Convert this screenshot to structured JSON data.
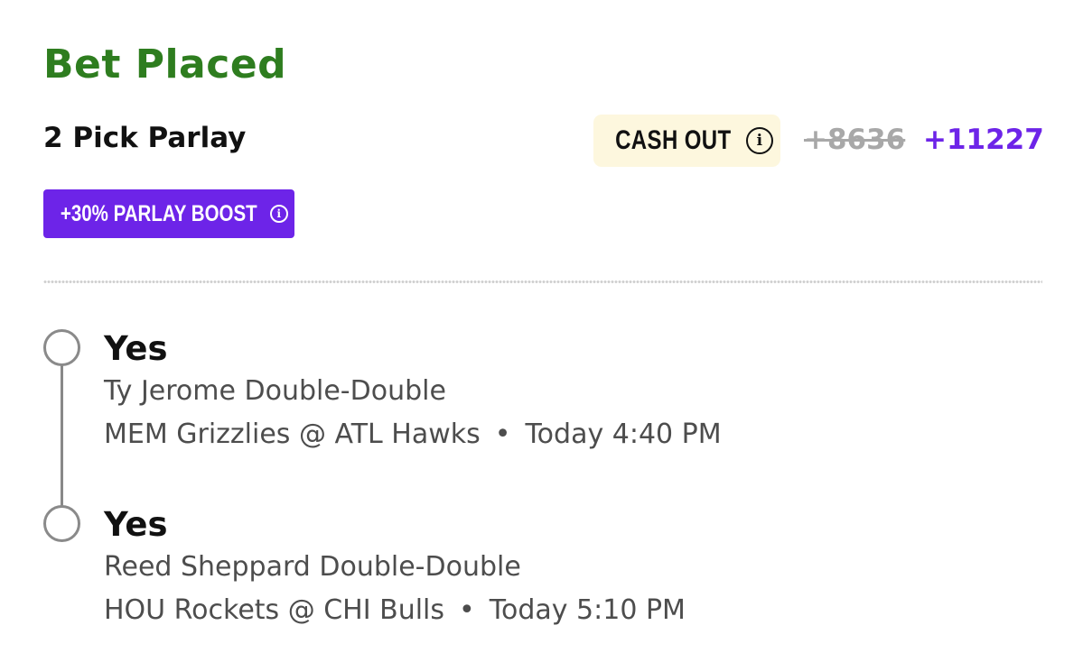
{
  "header": {
    "title": "Bet Placed",
    "parlay_label": "2 Pick Parlay"
  },
  "cashout": {
    "label": "CASH OUT",
    "info_icon": "info-icon",
    "background": "#fdf7de"
  },
  "odds": {
    "original": "+8636",
    "boosted": "+11227",
    "boosted_color": "#6d24e8"
  },
  "boost": {
    "label": "+30% PARLAY BOOST",
    "info_icon": "info-icon",
    "color": "#6d24e8"
  },
  "legs": [
    {
      "pick": "Yes",
      "market": "Ty Jerome Double-Double",
      "matchup": "MEM Grizzlies @ ATL Hawks",
      "separator": "•",
      "time": "Today 4:40 PM"
    },
    {
      "pick": "Yes",
      "market": "Reed Sheppard Double-Double",
      "matchup": "HOU Rockets @ CHI Bulls",
      "separator": "•",
      "time": "Today 5:10 PM"
    }
  ],
  "colors": {
    "title_green": "#2e7d1f",
    "secondary_text": "#4d4d4d"
  }
}
